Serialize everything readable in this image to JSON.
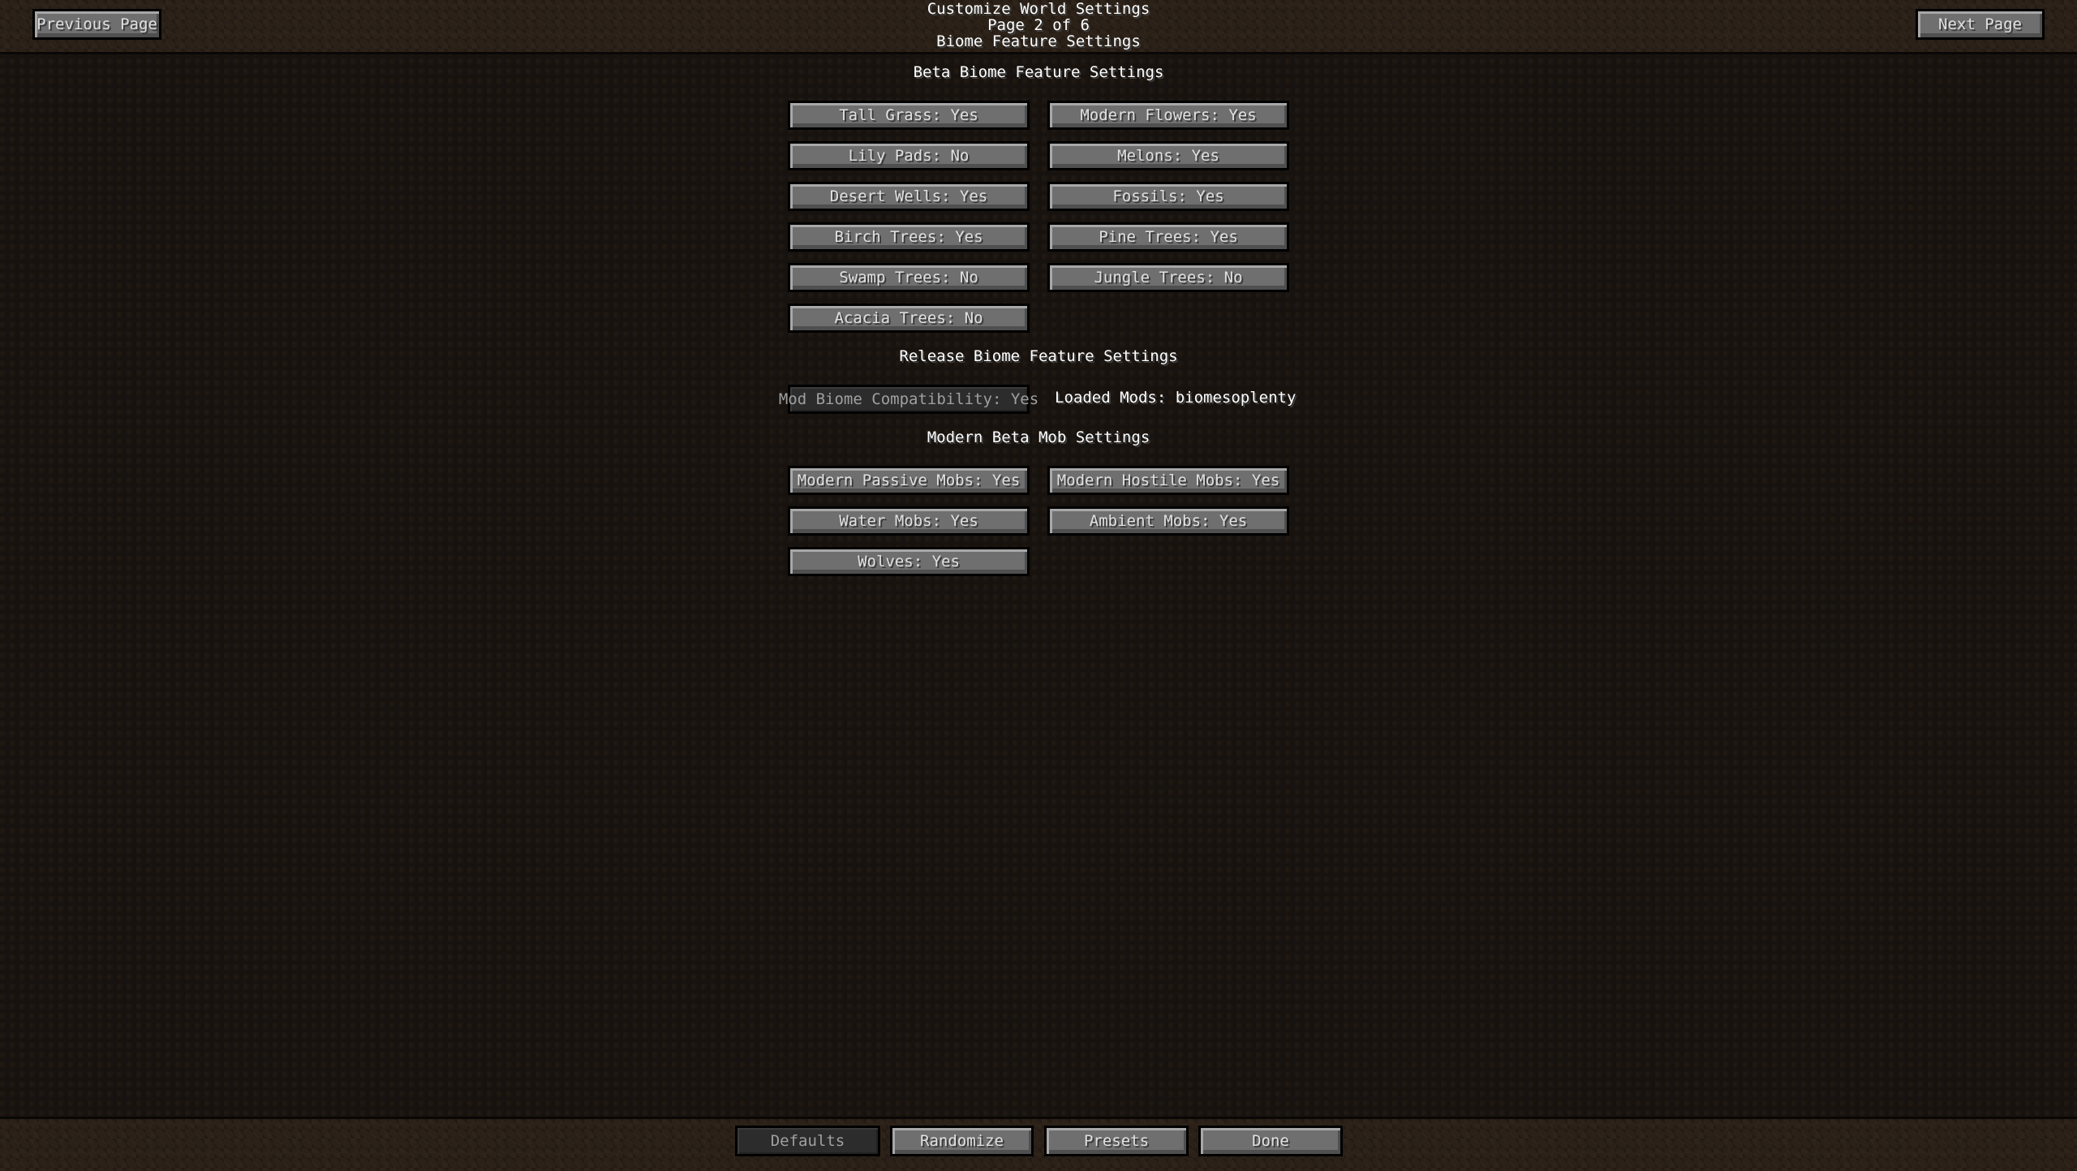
{
  "header": {
    "title": "Customize World Settings",
    "page_indicator": "Page 2 of 6",
    "page_name": "Biome Feature Settings",
    "prev_button": "Previous Page",
    "next_button": "Next Page"
  },
  "sections": {
    "beta_biome": {
      "title": "Beta Biome Feature Settings",
      "options": [
        {
          "label": "Tall Grass: Yes"
        },
        {
          "label": "Modern Flowers: Yes"
        },
        {
          "label": "Lily Pads: No"
        },
        {
          "label": "Melons: Yes"
        },
        {
          "label": "Desert Wells: Yes"
        },
        {
          "label": "Fossils: Yes"
        },
        {
          "label": "Birch Trees: Yes"
        },
        {
          "label": "Pine Trees: Yes"
        },
        {
          "label": "Swamp Trees: No"
        },
        {
          "label": "Jungle Trees: No"
        },
        {
          "label": "Acacia Trees: No"
        }
      ]
    },
    "release_biome": {
      "title": "Release Biome Feature Settings",
      "mod_compat_label": "Mod Biome Compatibility: Yes",
      "loaded_mods": "Loaded Mods: biomesoplenty"
    },
    "mob": {
      "title": "Modern Beta Mob Settings",
      "options": [
        {
          "label": "Modern Passive Mobs: Yes"
        },
        {
          "label": "Modern Hostile Mobs: Yes"
        },
        {
          "label": "Water Mobs: Yes"
        },
        {
          "label": "Ambient Mobs: Yes"
        },
        {
          "label": "Wolves: Yes"
        }
      ]
    }
  },
  "footer": {
    "defaults": "Defaults",
    "randomize": "Randomize",
    "presets": "Presets",
    "done": "Done"
  }
}
